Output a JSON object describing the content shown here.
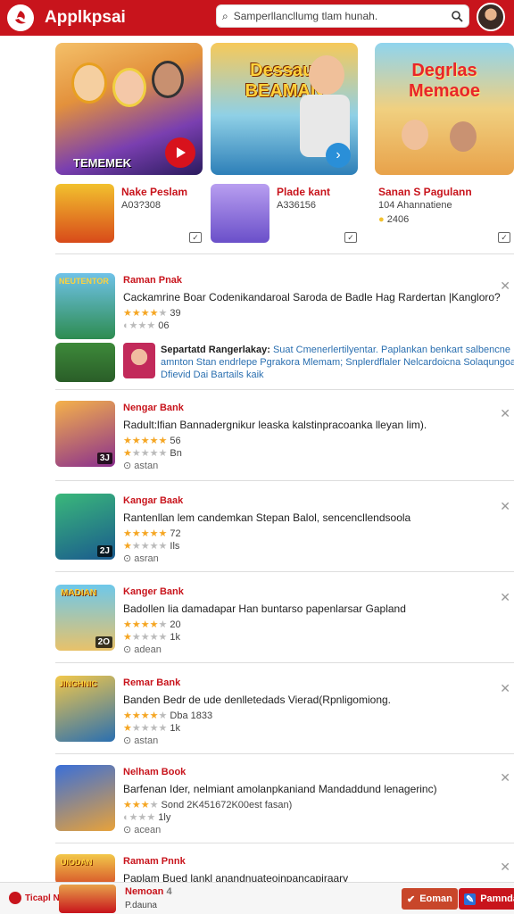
{
  "header": {
    "brand": "Applkpsai",
    "search_placeholder": "Samperllancllumg tlam hunah.",
    "icons": [
      "logo-icon",
      "search-icon",
      "avatar"
    ]
  },
  "featured": [
    {
      "banner_title": "",
      "banner_badge": "TEMEMEK",
      "name": "Nake Peslam",
      "sub": "A03?308"
    },
    {
      "banner_title": "Dessaul BEAMAN",
      "banner_badge": "",
      "name": "Plade kant",
      "sub": "A336156"
    },
    {
      "banner_title": "Degrlas Memaoe",
      "banner_badge": "",
      "name": "Sanan S Pagulann",
      "sub": "104 Ahannatiene",
      "sub2": "2406"
    }
  ],
  "list": [
    {
      "title": "Raman Pnak",
      "desc": "Cackamrine Boar Codenikandaroal Saroda de Badle Hag Rardertan |Kangloro?",
      "rating": "39",
      "meta": "06",
      "thumb_text": "NEUTENTOR",
      "thumb_num": "",
      "extra_title": "Separtatd Rangerlakay:",
      "extra_desc": "Suat Cmenerlertilyentar. Paplankan benkart salbencne",
      "extra_desc2": "amnton Stan endrlepe Pgrakora Mlemam; Snplerdflaler Nelcardoicna Solaqungoan",
      "extra_link": "Dfievid Dai Bartails kaik"
    },
    {
      "title": "Nengar Bank",
      "desc": "Radult:lfian Bannadergnikur leaska kalstinpracoanka lleyan lim).",
      "rating": "56",
      "rating2": "Bn",
      "meta": "astan",
      "thumb_num": "3J"
    },
    {
      "title": "Kangar Baak",
      "desc": "Rantenllan lem candemkan Stepan Balol, sencencllendsoola",
      "rating": "72",
      "rating2": "Ils",
      "meta": "asran",
      "thumb_num": "2J"
    },
    {
      "title": "Kanger Bank",
      "desc": "Badollen lia damadapar Han buntarso papenlarsar Gapland",
      "rating": "20",
      "rating2": "1k",
      "meta": "adean",
      "thumb_text": "MADIAN",
      "thumb_num": "2O"
    },
    {
      "title": "Remar Bank",
      "desc": "Banden Bedr de ude denlletedads Vierad(Rpnligomiong.",
      "rating": "Dba 1833",
      "rating2": "1k",
      "meta": "astan",
      "thumb_text": "JINGHNIC"
    },
    {
      "title": "Nelham Book",
      "desc": "Barfenan Ider, nelmiant amolanpkaniand Mandaddund lenagerinc)",
      "rating": "Sond 2K451672K00est fasan)",
      "rating2": "1ly",
      "meta": "acean"
    },
    {
      "title": "Ramam Pnnk",
      "desc": "Paplam Bued lankl anandnuateoinpancapiraary",
      "thumb_text": "UIODAN"
    }
  ],
  "bottom": {
    "tag": "Ticapl Nolls",
    "name": "Nemoan",
    "name_suffix": "4",
    "sub": "P.dauna",
    "btn1": "Eoman",
    "btn2": "Pamndan",
    "accent": "#c8141c"
  }
}
